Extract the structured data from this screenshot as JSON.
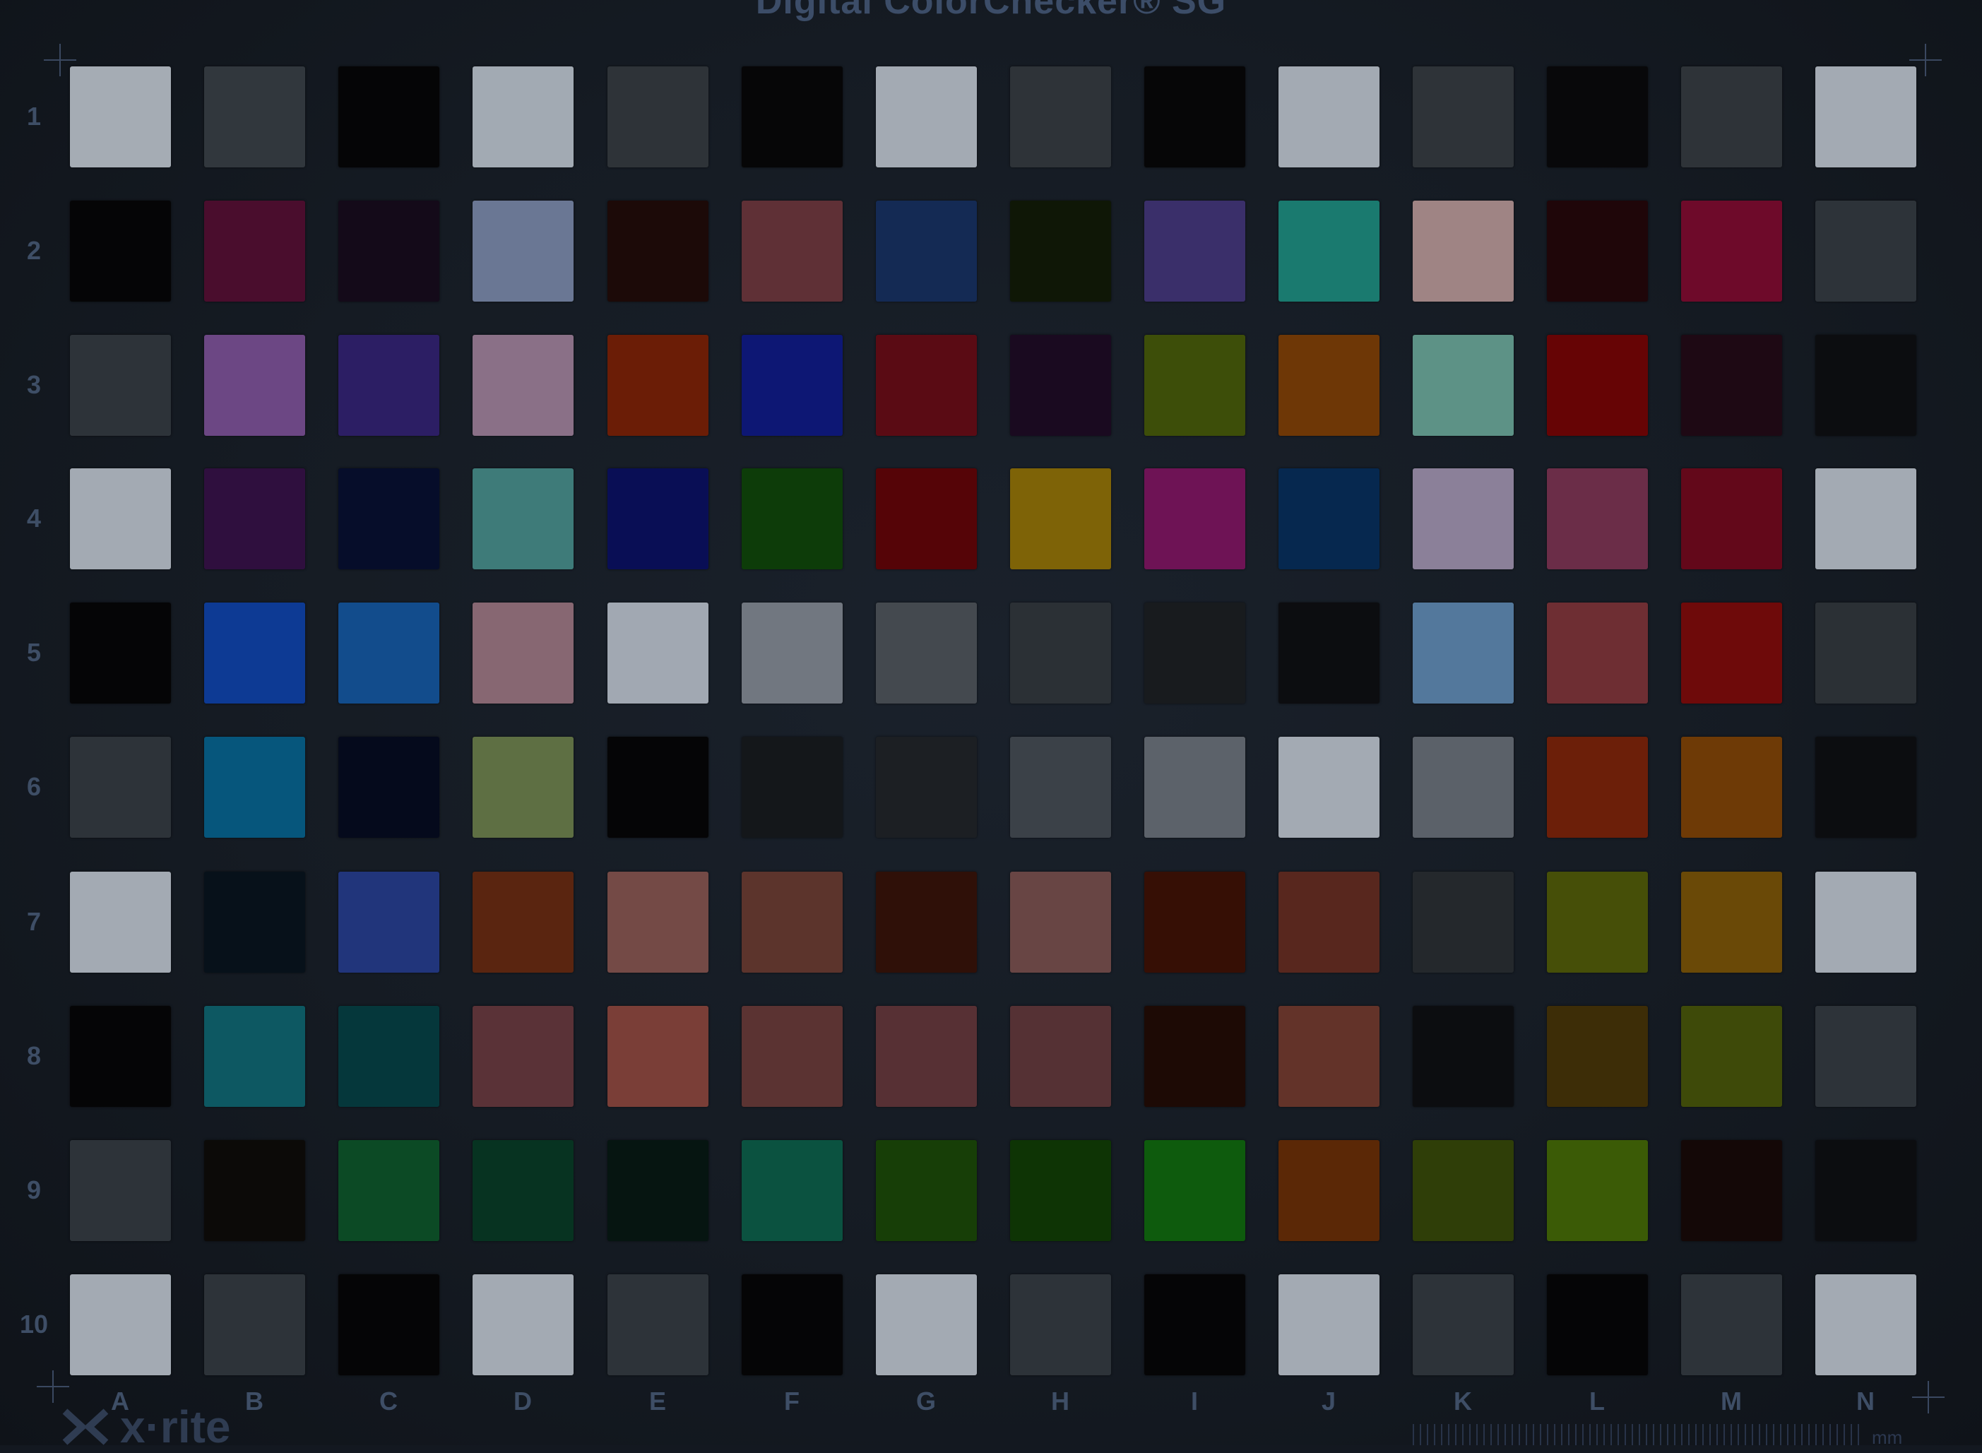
{
  "chart_title": "Digital ColorChecker® SG",
  "brand": "x·rite",
  "ruler_unit": "mm",
  "rows": [
    "1",
    "2",
    "3",
    "4",
    "5",
    "6",
    "7",
    "8",
    "9",
    "10"
  ],
  "columns": [
    "A",
    "B",
    "C",
    "D",
    "E",
    "F",
    "G",
    "H",
    "I",
    "J",
    "K",
    "L",
    "M",
    "N"
  ],
  "icons": {
    "crosshair": "crosshair-icon",
    "logo": "xrite-logo-icon"
  },
  "patch_colors": [
    [
      "#a5acb4",
      "#31373d",
      "#050506",
      "#a2aab3",
      "#2e3338",
      "#060607",
      "#a3aab3",
      "#2e3338",
      "#060607",
      "#a3aab3",
      "#2e3338",
      "#08080a",
      "#2e3338",
      "#a3aab3"
    ],
    [
      "#050506",
      "#4a0d2d",
      "#140a19",
      "#6a7794",
      "#1c0a08",
      "#5f3036",
      "#142a54",
      "#0f1706",
      "#3a2f6a",
      "#1a7a6f",
      "#9f8484",
      "#1f0609",
      "#6e0a2a",
      "#2d3339"
    ],
    [
      "#2d3339",
      "#6c4784",
      "#2c1e64",
      "#8a7087",
      "#6b1d06",
      "#0d1774",
      "#5a0b14",
      "#1a0a20",
      "#3d4e09",
      "#6e3706",
      "#5d9286",
      "#660405",
      "#1e0914",
      "#0c0d10"
    ],
    [
      "#a3aab3",
      "#2f0f3e",
      "#060d2a",
      "#3e7b79",
      "#090e55",
      "#0d3c09",
      "#550407",
      "#7e6307",
      "#6e1355",
      "#06284f",
      "#8b8099",
      "#6b2d48",
      "#63081a",
      "#a3aab3"
    ],
    [
      "#050506",
      "#0d3a94",
      "#124c8c",
      "#876772",
      "#a1a8b2",
      "#717780",
      "#44494f",
      "#2b3035",
      "#181b1e",
      "#0c0d10",
      "#53789c",
      "#6e2e33",
      "#6e0a0a",
      "#2b3035"
    ],
    [
      "#2d3339",
      "#06567c",
      "#050a1c",
      "#5e6f43",
      "#050506",
      "#14171a",
      "#1c1f23",
      "#3b4148",
      "#5c626a",
      "#a3aab3",
      "#5b6169",
      "#6c1f09",
      "#6e3a06",
      "#0c0d10"
    ],
    [
      "#a3aab3",
      "#07111a",
      "#21357b",
      "#5a2510",
      "#744a46",
      "#5c342c",
      "#2f1008",
      "#684544",
      "#360f05",
      "#58271e",
      "#24282c",
      "#464f08",
      "#6a4907",
      "#a3aab3"
    ],
    [
      "#050506",
      "#0d5862",
      "#05373b",
      "#5a3237",
      "#7a3e37",
      "#5b3332",
      "#573034",
      "#553134",
      "#1d0a05",
      "#633329",
      "#0c0d10",
      "#3d2d07",
      "#3e4a09",
      "#2d3339"
    ],
    [
      "#2d3339",
      "#0c0a08",
      "#0c4a25",
      "#073321",
      "#061511",
      "#0b5240",
      "#173e07",
      "#0e3405",
      "#0e5b0d",
      "#5b2806",
      "#2f3e08",
      "#3b5b06",
      "#140807",
      "#0c0d10"
    ],
    [
      "#a3aab3",
      "#2d3339",
      "#050506",
      "#a3aab3",
      "#2d3339",
      "#050506",
      "#a3aab3",
      "#2d3339",
      "#050506",
      "#a3aab3",
      "#2d3339",
      "#050506",
      "#2d3339",
      "#a3aab3"
    ]
  ]
}
